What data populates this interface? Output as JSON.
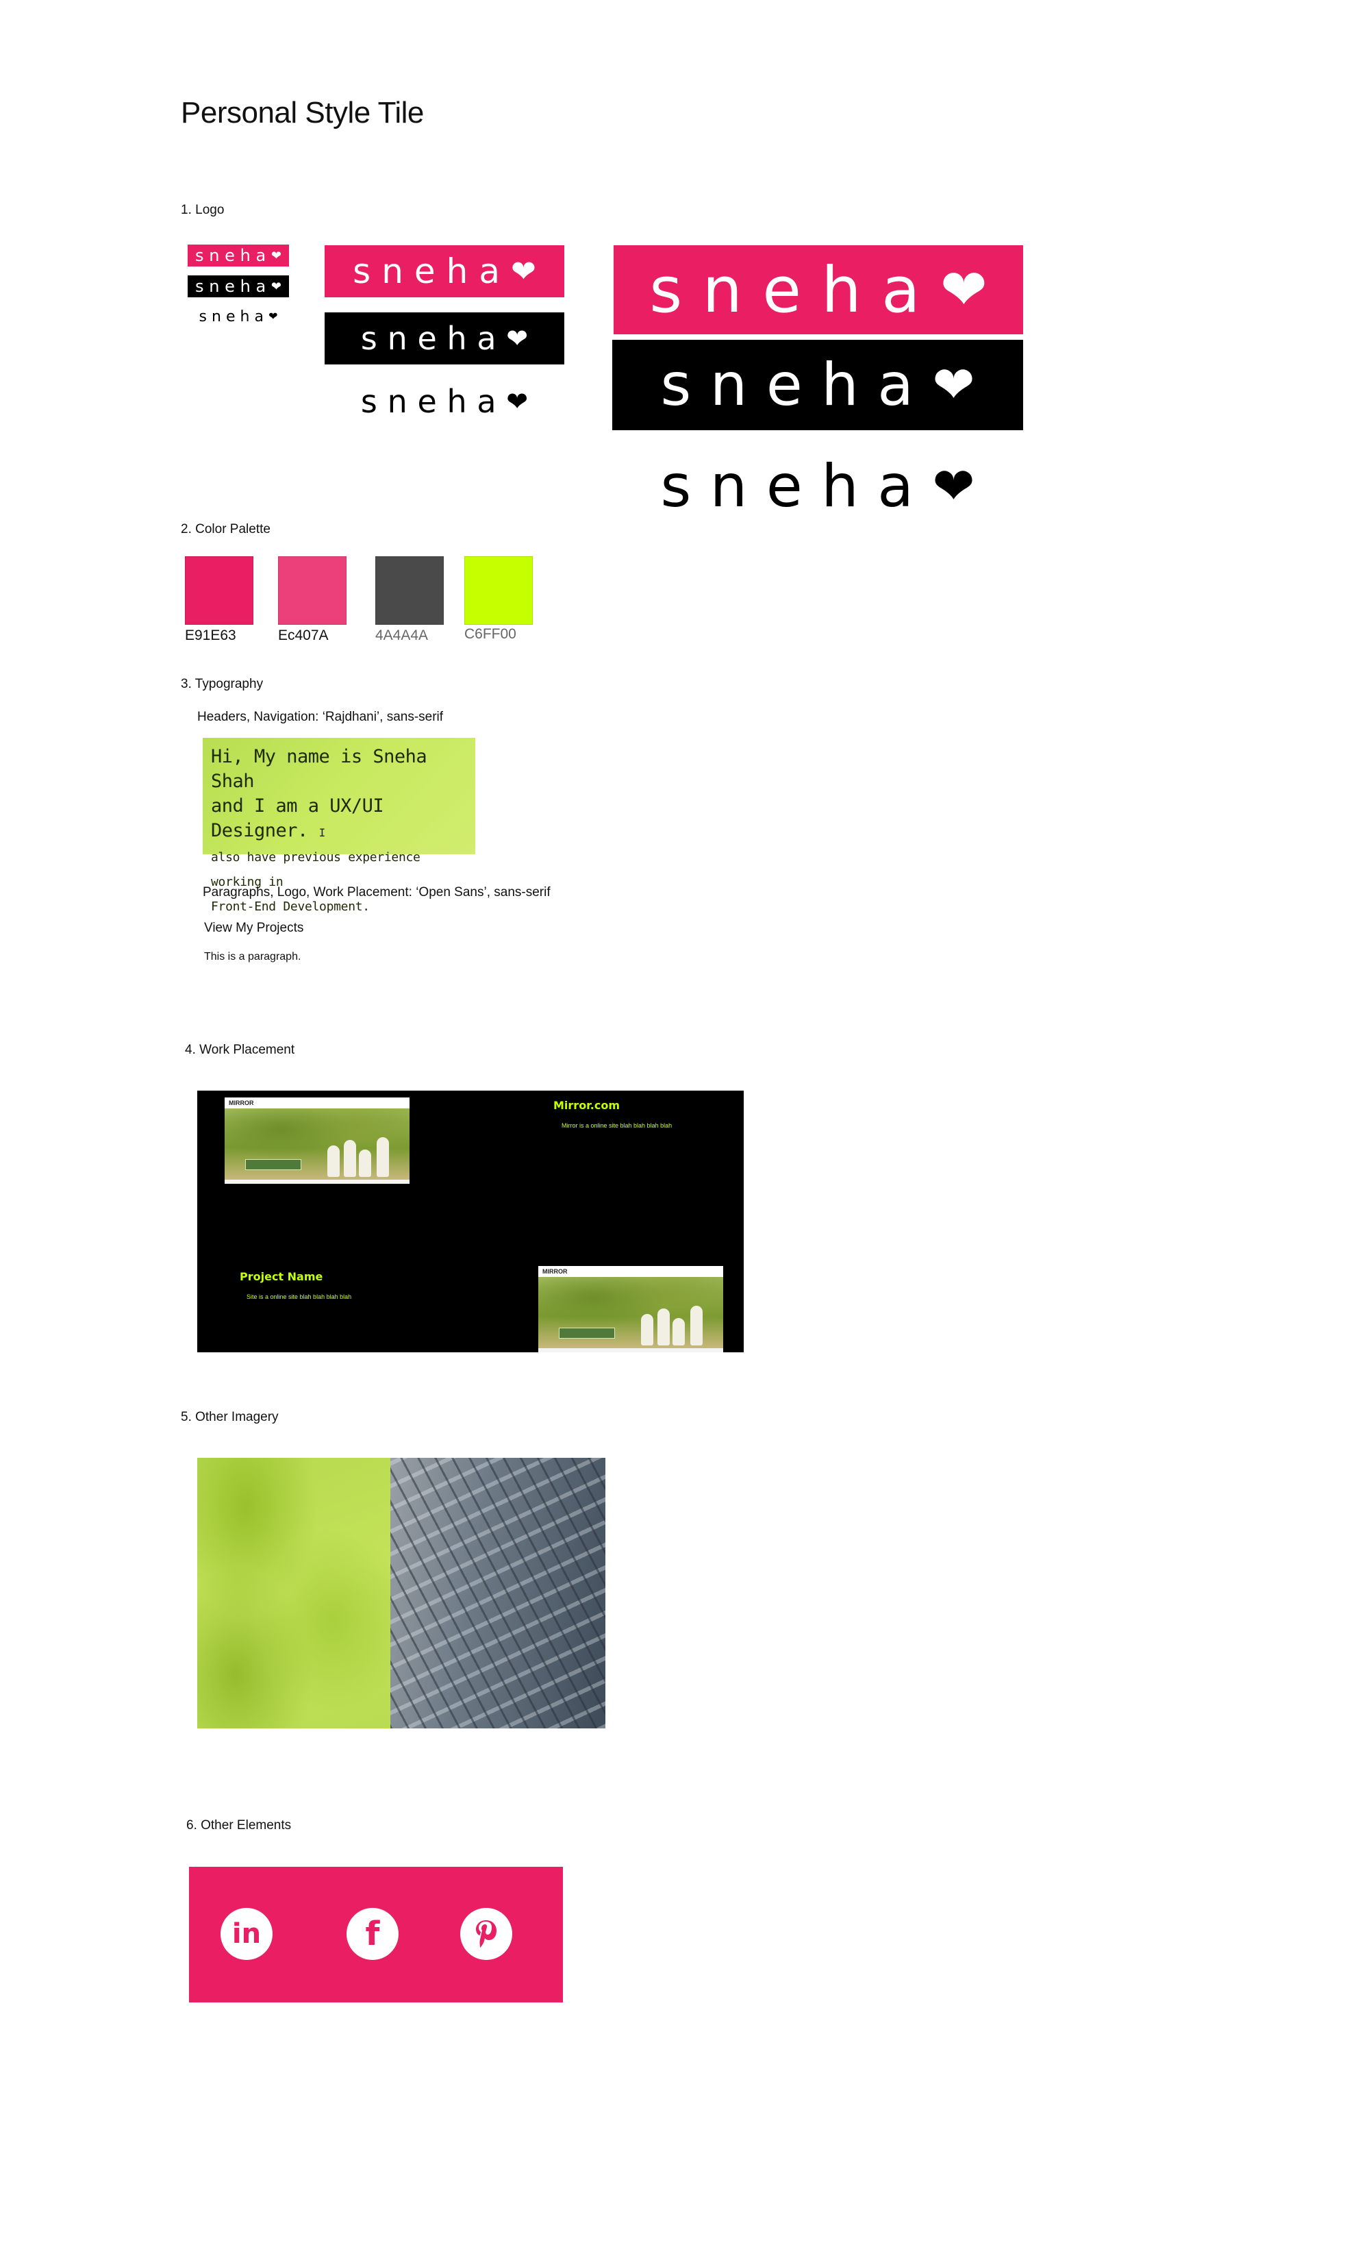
{
  "page_title": "Personal Style Tile",
  "sections": {
    "logo": "1. Logo",
    "color": "2. Color Palette",
    "typography": "3. Typography",
    "work": "4. Work Placement",
    "imagery": "5. Other Imagery",
    "elements": "6. Other Elements"
  },
  "logo": {
    "text": "sneha",
    "heart": "❤"
  },
  "palette": [
    {
      "hex": "E91E63",
      "color": "#E91E63"
    },
    {
      "hex": "Ec407A",
      "color": "#EC407A"
    },
    {
      "hex": "4A4A4A",
      "color": "#4A4A4A"
    },
    {
      "hex": "C6FF00",
      "color": "#C6FF00"
    }
  ],
  "typography": {
    "headers_label": "Headers, Navigation: ‘Rajdhani’, sans-serif",
    "sample_line1": "Hi, My name is Sneha Shah",
    "sample_line2": "and I am a UX/UI Designer.",
    "sample_line2_tail": "I",
    "sample_line3": "also have previous experience working in",
    "sample_line4": "Front-End Development.",
    "paragraphs_label": "Paragraphs,  Logo, Work Placement: ‘Open Sans’, sans-serif",
    "link_sample": "View My Projects",
    "paragraph_sample": "This is a paragraph."
  },
  "work": {
    "project1_title": "Mirror.com",
    "project1_desc": "Mirror is a online site blah blah blah blah",
    "project2_title": "Project Name",
    "project2_desc": "Site is a online site blah blah blah blah",
    "thumb_logo": "MIRROR"
  },
  "social": [
    "linkedin-icon",
    "facebook-icon",
    "pinterest-icon"
  ]
}
